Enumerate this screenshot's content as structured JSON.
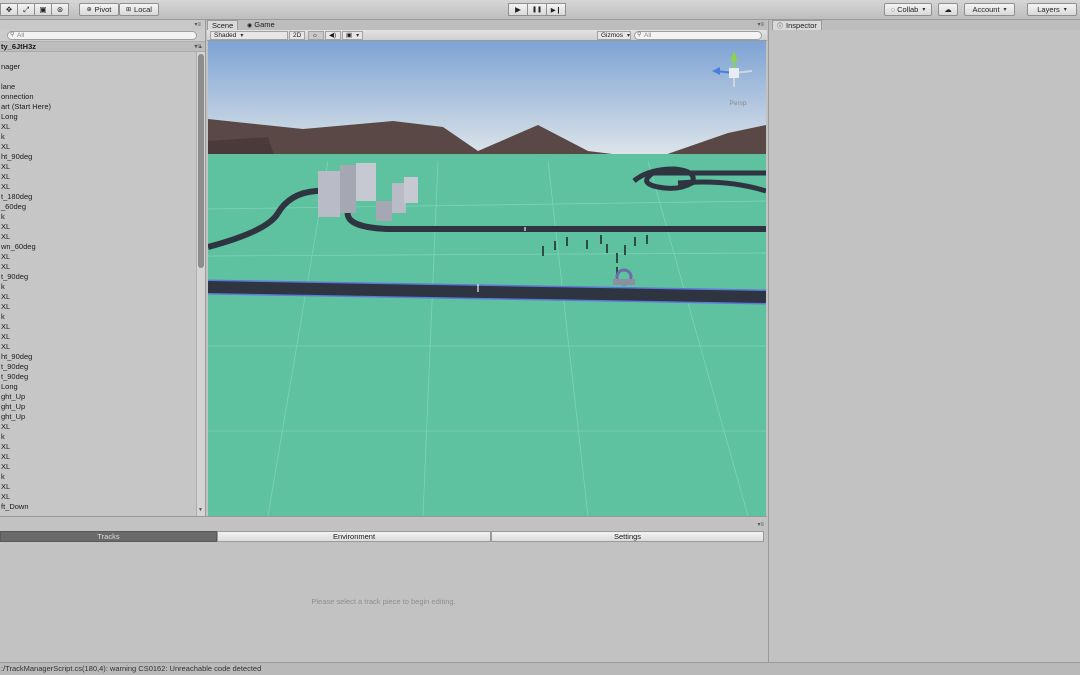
{
  "toolbar": {
    "tools": [
      {
        "icon": "move-tool-icon",
        "glyph": "✥"
      },
      {
        "icon": "scale-tool-icon",
        "glyph": "⤢"
      },
      {
        "icon": "rect-tool-icon",
        "glyph": "▣"
      },
      {
        "icon": "transform-tool-icon",
        "glyph": "⊛"
      }
    ],
    "pivot_label": "Pivot",
    "local_label": "Local",
    "play_glyph": "▶",
    "pause_glyph": "❚❚",
    "step_glyph": "▶❙",
    "collab_label": "Collab",
    "cloud_glyph": "☁",
    "account_label": "Account",
    "layers_label": "Layers"
  },
  "hierarchy": {
    "search_placeholder": "All",
    "scene_name": "ty_6JtH3z",
    "items": [
      "nager",
      "",
      "lane",
      "onnection",
      "art (Start Here)",
      "Long",
      "XL",
      "k",
      "XL",
      "ht_90deg",
      "XL",
      "XL",
      "XL",
      "t_180deg",
      "_60deg",
      "k",
      "XL",
      "XL",
      "wn_60deg",
      "XL",
      "XL",
      "t_90deg",
      "k",
      "XL",
      "XL",
      "k",
      "XL",
      "XL",
      "XL",
      "ht_90deg",
      "t_90deg",
      "t_90deg",
      "Long",
      "ght_Up",
      "ght_Up",
      "ght_Up",
      "XL",
      "k",
      "XL",
      "XL",
      "XL",
      "k",
      "XL",
      "XL",
      "ft_Down"
    ]
  },
  "scene": {
    "tabs": [
      "Scene",
      "Game"
    ],
    "shading_mode": "Shaded",
    "mode_2d_label": "2D",
    "light_glyph": "☼",
    "audio_glyph": "◀)",
    "effects_glyph": "▣",
    "gizmos_label": "Gizmos",
    "search_placeholder": "All",
    "projection_label": "Persp",
    "colors": {
      "sky_top": "#7ea3d4",
      "sky_horizon": "#d9e3ea",
      "ground": "#5ec1a0",
      "mountain": "#5a4846",
      "road": "#2f3441",
      "road_edge": "#5d6fe0"
    }
  },
  "inspector": {
    "tab_label": "Inspector"
  },
  "bottom_panel": {
    "tabs": [
      "Tracks",
      "Environment",
      "Settings"
    ],
    "active_tab": "Tracks",
    "message": "Please select a track piece to begin editing."
  },
  "status": {
    "text": ":/TrackManagerScript.cs(180,4): warning CS0162: Unreachable code detected"
  }
}
